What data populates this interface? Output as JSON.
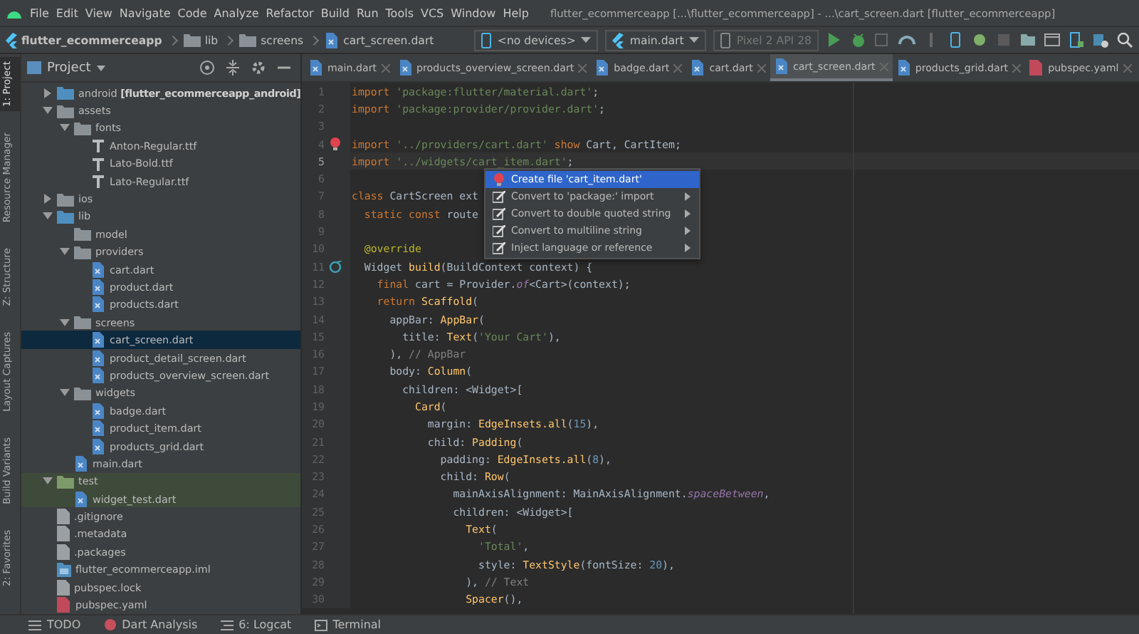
{
  "menu_bar": {
    "items": [
      "File",
      "Edit",
      "View",
      "Navigate",
      "Code",
      "Analyze",
      "Refactor",
      "Build",
      "Run",
      "Tools",
      "VCS",
      "Window",
      "Help"
    ],
    "title": "flutter_ecommerceapp [...\\flutter_ecommerceapp] - ...\\cart_screen.dart [flutter_ecommerceapp]"
  },
  "breadcrumb": [
    {
      "label": "flutter_ecommerceapp",
      "kind": "project"
    },
    {
      "label": "lib",
      "kind": "folder"
    },
    {
      "label": "screens",
      "kind": "folder"
    },
    {
      "label": "cart_screen.dart",
      "kind": "dart"
    }
  ],
  "run_toolbar": {
    "device": "<no devices>",
    "configuration": "main.dart",
    "emulator": {
      "label": "Pixel 2 API 28",
      "disabled": true
    }
  },
  "tool_strip": [
    {
      "label": "1: Project",
      "selected": true
    },
    {
      "label": "Resource Manager",
      "selected": false
    },
    {
      "label": "Z: Structure",
      "selected": false
    },
    {
      "label": "Layout Captures",
      "selected": false
    },
    {
      "label": "Build Variants",
      "selected": false
    },
    {
      "label": "2: Favorites",
      "selected": false
    }
  ],
  "project_panel": {
    "title": "Project",
    "tree": [
      {
        "label": "android **[flutter_ecommerceapp_android]**",
        "kind": "module",
        "expanded": false,
        "selected": false
      },
      {
        "label": "assets",
        "kind": "folder",
        "expanded": true,
        "selected": false,
        "children": [
          {
            "label": "fonts",
            "kind": "folder",
            "expanded": true,
            "selected": false,
            "children": [
              {
                "label": "Anton-Regular.ttf",
                "kind": "font",
                "selected": false
              },
              {
                "label": "Lato-Bold.ttf",
                "kind": "font",
                "selected": false
              },
              {
                "label": "Lato-Regular.ttf",
                "kind": "font",
                "selected": false
              }
            ]
          }
        ]
      },
      {
        "label": "ios",
        "kind": "folder",
        "expanded": false,
        "selected": false
      },
      {
        "label": "lib",
        "kind": "module",
        "expanded": true,
        "selected": false,
        "children": [
          {
            "label": "model",
            "kind": "folder",
            "selected": false
          },
          {
            "label": "providers",
            "kind": "folder",
            "expanded": true,
            "selected": false,
            "children": [
              {
                "label": "cart.dart",
                "kind": "dart",
                "selected": false
              },
              {
                "label": "product.dart",
                "kind": "dart",
                "selected": false
              },
              {
                "label": "products.dart",
                "kind": "dart",
                "selected": false
              }
            ]
          },
          {
            "label": "screens",
            "kind": "folder",
            "expanded": true,
            "selected": false,
            "children": [
              {
                "label": "cart_screen.dart",
                "kind": "dart",
                "selected": true
              },
              {
                "label": "product_detail_screen.dart",
                "kind": "dart",
                "selected": false
              },
              {
                "label": "products_overview_screen.dart",
                "kind": "dart",
                "selected": false
              }
            ]
          },
          {
            "label": "widgets",
            "kind": "folder",
            "expanded": true,
            "selected": false,
            "children": [
              {
                "label": "badge.dart",
                "kind": "dart",
                "selected": false
              },
              {
                "label": "product_item.dart",
                "kind": "dart",
                "selected": false
              },
              {
                "label": "products_grid.dart",
                "kind": "dart",
                "selected": false
              }
            ]
          },
          {
            "label": "main.dart",
            "kind": "dart",
            "selected": false
          }
        ]
      },
      {
        "label": "test",
        "kind": "test-folder",
        "expanded": true,
        "selected": false,
        "children": [
          {
            "label": "widget_test.dart",
            "kind": "dart",
            "selected": false
          }
        ]
      },
      {
        "label": ".gitignore",
        "kind": "file",
        "selected": false
      },
      {
        "label": ".metadata",
        "kind": "file",
        "selected": false
      },
      {
        "label": ".packages",
        "kind": "file",
        "selected": false
      },
      {
        "label": "flutter_ecommerceapp.iml",
        "kind": "iml",
        "selected": false
      },
      {
        "label": "pubspec.lock",
        "kind": "file",
        "selected": false
      },
      {
        "label": "pubspec.yaml",
        "kind": "yaml",
        "selected": false
      }
    ]
  },
  "tabs": [
    {
      "label": "main.dart",
      "kind": "dart",
      "selected": false
    },
    {
      "label": "products_overview_screen.dart",
      "kind": "dart",
      "selected": false
    },
    {
      "label": "badge.dart",
      "kind": "dart",
      "selected": false
    },
    {
      "label": "cart.dart",
      "kind": "dart",
      "selected": false
    },
    {
      "label": "cart_screen.dart",
      "kind": "dart",
      "selected": true
    },
    {
      "label": "products_grid.dart",
      "kind": "dart",
      "selected": false
    },
    {
      "label": "pubspec.yaml",
      "kind": "yaml",
      "selected": false
    }
  ],
  "editor": {
    "lines": [
      {
        "number": "1",
        "kind": "code",
        "current": false,
        "tokens": [
          {
            "kind": "kw",
            "text": "import"
          },
          {
            "kind": "s",
            "text": " 'package:flutter/material.dart'"
          },
          {
            "kind": "p",
            "text": ";"
          }
        ]
      },
      {
        "number": "2",
        "kind": "code",
        "current": false,
        "tokens": [
          {
            "kind": "kw",
            "text": "import"
          },
          {
            "kind": "s",
            "text": " 'package:provider/provider.dart'"
          },
          {
            "kind": "p",
            "text": ";"
          }
        ]
      },
      {
        "number": "3",
        "kind": "code",
        "current": false
      },
      {
        "number": "4",
        "kind": "intention",
        "current": false,
        "tokens": [
          {
            "kind": "kw",
            "text": "import"
          },
          {
            "kind": "s",
            "text": " '../providers/cart.dart'"
          },
          {
            "kind": "kw",
            "text": " show"
          },
          {
            "kind": "p",
            "text": " Cart, CartItem;"
          }
        ]
      },
      {
        "number": "5",
        "kind": "code",
        "current": true,
        "tokens": [
          {
            "kind": "kw",
            "text": "import"
          },
          {
            "kind": "s",
            "text": " '../widgets/cart_item.dart'"
          },
          {
            "kind": "p",
            "text": ";"
          }
        ]
      },
      {
        "number": "6",
        "kind": "code",
        "current": false
      },
      {
        "number": "7",
        "kind": "code",
        "current": false,
        "tokens": [
          {
            "kind": "kw",
            "text": "class"
          },
          {
            "kind": "p",
            "text": " CartScreen ext"
          }
        ]
      },
      {
        "number": "8",
        "kind": "code",
        "current": false,
        "tokens": [
          {
            "kind": "kw",
            "text": "  static const"
          },
          {
            "kind": "p",
            "text": " route"
          }
        ]
      },
      {
        "number": "9",
        "kind": "code",
        "current": false
      },
      {
        "number": "10",
        "kind": "code",
        "current": false,
        "tokens": [
          {
            "kind": "a",
            "text": "  @override"
          }
        ]
      },
      {
        "number": "11",
        "kind": "override",
        "current": false,
        "tokens": [
          {
            "kind": "p",
            "text": "  Widget "
          },
          {
            "kind": "f",
            "text": "build"
          },
          {
            "kind": "p",
            "text": "(BuildContext context) {"
          }
        ]
      },
      {
        "number": "12",
        "kind": "code",
        "current": false,
        "tokens": [
          {
            "kind": "kw",
            "text": "    final"
          },
          {
            "kind": "p",
            "text": " cart = Provider."
          },
          {
            "kind": "i",
            "text": "of"
          },
          {
            "kind": "p",
            "text": "<Cart>(context);"
          }
        ]
      },
      {
        "number": "13",
        "kind": "code",
        "current": false,
        "tokens": [
          {
            "kind": "kw",
            "text": "    return"
          },
          {
            "kind": "c",
            "text": " Scaffold"
          },
          {
            "kind": "p",
            "text": "("
          }
        ]
      },
      {
        "number": "14",
        "kind": "code",
        "current": false,
        "tokens": [
          {
            "kind": "p",
            "text": "      appBar: "
          },
          {
            "kind": "c",
            "text": "AppBar"
          },
          {
            "kind": "p",
            "text": "("
          }
        ]
      },
      {
        "number": "15",
        "kind": "code",
        "current": false,
        "tokens": [
          {
            "kind": "p",
            "text": "        title: "
          },
          {
            "kind": "c",
            "text": "Text"
          },
          {
            "kind": "p",
            "text": "("
          },
          {
            "kind": "s",
            "text": "'Your Cart'"
          },
          {
            "kind": "p",
            "text": "),"
          }
        ]
      },
      {
        "number": "16",
        "kind": "code",
        "current": false,
        "tokens": [
          {
            "kind": "p",
            "text": "      ), "
          },
          {
            "kind": "m",
            "text": "// AppBar"
          }
        ]
      },
      {
        "number": "17",
        "kind": "code",
        "current": false,
        "tokens": [
          {
            "kind": "p",
            "text": "      body: "
          },
          {
            "kind": "c",
            "text": "Column"
          },
          {
            "kind": "p",
            "text": "("
          }
        ]
      },
      {
        "number": "18",
        "kind": "code",
        "current": false,
        "tokens": [
          {
            "kind": "p",
            "text": "        children: <Widget>["
          }
        ]
      },
      {
        "number": "19",
        "kind": "code",
        "current": false,
        "tokens": [
          {
            "kind": "c",
            "text": "          Card"
          },
          {
            "kind": "p",
            "text": "("
          }
        ]
      },
      {
        "number": "20",
        "kind": "code",
        "current": false,
        "tokens": [
          {
            "kind": "p",
            "text": "            margin: "
          },
          {
            "kind": "c",
            "text": "EdgeInsets.all"
          },
          {
            "kind": "p",
            "text": "("
          },
          {
            "kind": "n",
            "text": "15"
          },
          {
            "kind": "p",
            "text": "),"
          }
        ]
      },
      {
        "number": "21",
        "kind": "code",
        "current": false,
        "tokens": [
          {
            "kind": "p",
            "text": "            child: "
          },
          {
            "kind": "c",
            "text": "Padding"
          },
          {
            "kind": "p",
            "text": "("
          }
        ]
      },
      {
        "number": "22",
        "kind": "code",
        "current": false,
        "tokens": [
          {
            "kind": "p",
            "text": "              padding: "
          },
          {
            "kind": "c",
            "text": "EdgeInsets.all"
          },
          {
            "kind": "p",
            "text": "("
          },
          {
            "kind": "n",
            "text": "8"
          },
          {
            "kind": "p",
            "text": "),"
          }
        ]
      },
      {
        "number": "23",
        "kind": "code",
        "current": false,
        "tokens": [
          {
            "kind": "p",
            "text": "              child: "
          },
          {
            "kind": "c",
            "text": "Row"
          },
          {
            "kind": "p",
            "text": "("
          }
        ]
      },
      {
        "number": "24",
        "kind": "code",
        "current": false,
        "tokens": [
          {
            "kind": "p",
            "text": "                mainAxisAlignment: MainAxisAlignment."
          },
          {
            "kind": "i",
            "text": "spaceBetween"
          },
          {
            "kind": "p",
            "text": ","
          }
        ]
      },
      {
        "number": "25",
        "kind": "code",
        "current": false,
        "tokens": [
          {
            "kind": "p",
            "text": "                children: <Widget>["
          }
        ]
      },
      {
        "number": "26",
        "kind": "code",
        "current": false,
        "tokens": [
          {
            "kind": "c",
            "text": "                  Text"
          },
          {
            "kind": "p",
            "text": "("
          }
        ]
      },
      {
        "number": "27",
        "kind": "code",
        "current": false,
        "tokens": [
          {
            "kind": "s",
            "text": "                    'Total'"
          },
          {
            "kind": "p",
            "text": ","
          }
        ]
      },
      {
        "number": "28",
        "kind": "code",
        "current": false,
        "tokens": [
          {
            "kind": "p",
            "text": "                    style: "
          },
          {
            "kind": "c",
            "text": "TextStyle"
          },
          {
            "kind": "p",
            "text": "(fontSize: "
          },
          {
            "kind": "n",
            "text": "20"
          },
          {
            "kind": "p",
            "text": "),"
          }
        ]
      },
      {
        "number": "29",
        "kind": "code",
        "current": false,
        "tokens": [
          {
            "kind": "p",
            "text": "                  ), "
          },
          {
            "kind": "m",
            "text": "// Text"
          }
        ]
      },
      {
        "number": "30",
        "kind": "code",
        "current": false,
        "tokens": [
          {
            "kind": "c",
            "text": "                  Spacer"
          },
          {
            "kind": "p",
            "text": "(),"
          }
        ]
      }
    ]
  },
  "intention_menu": {
    "items": [
      {
        "label": "Create file 'cart_item.dart'",
        "kind": "bulb",
        "submenu": false,
        "selected": true
      },
      {
        "label": "Convert to 'package:' import",
        "kind": "edit",
        "submenu": true,
        "selected": false
      },
      {
        "label": "Convert to double quoted string",
        "kind": "edit",
        "submenu": true,
        "selected": false
      },
      {
        "label": "Convert to multiline string",
        "kind": "edit",
        "submenu": true,
        "selected": false
      },
      {
        "label": "Inject language or reference",
        "kind": "edit",
        "submenu": true,
        "selected": false
      }
    ]
  },
  "bottom_bar": [
    {
      "label": "TODO",
      "kind": "todo"
    },
    {
      "label": "Dart Analysis",
      "kind": "dart-analysis"
    },
    {
      "label": "6: Logcat",
      "kind": "logcat"
    },
    {
      "label": "Terminal",
      "kind": "terminal"
    }
  ]
}
